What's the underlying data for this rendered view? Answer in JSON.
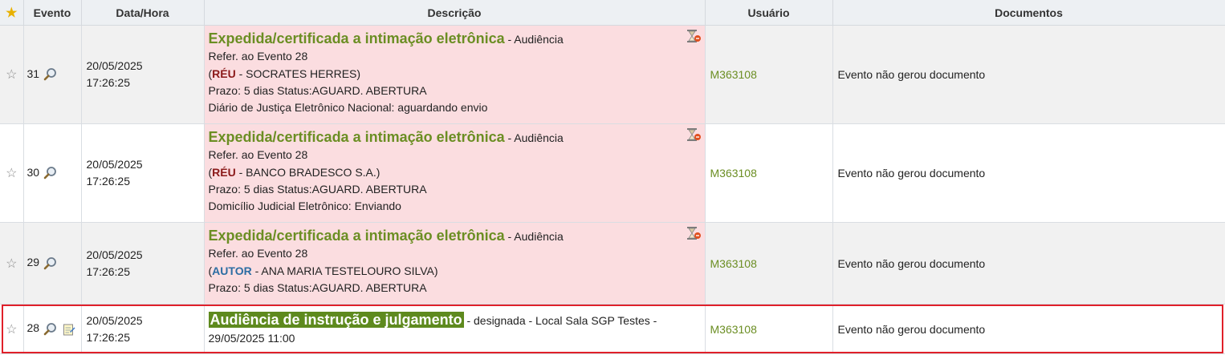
{
  "header": {
    "evento": "Evento",
    "data_hora": "Data/Hora",
    "descricao": "Descrição",
    "usuario": "Usuário",
    "documentos": "Documentos"
  },
  "rows": [
    {
      "evento": "31",
      "date": "20/05/2025",
      "time": "17:26:25",
      "title": "Expedida/certificada a intimação eletrônica",
      "title_suffix": " - Audiência",
      "refer": "Refer. ao Evento 28",
      "party_role": "RÉU",
      "party_name": " - SOCRATES HERRES)",
      "prazo": "Prazo: 5 dias Status:AGUARD. ABERTURA",
      "extra": "Diário de Justiça Eletrônico Nacional: aguardando envio",
      "usuario": "M363108",
      "documentos": "Evento não gerou documento"
    },
    {
      "evento": "30",
      "date": "20/05/2025",
      "time": "17:26:25",
      "title": "Expedida/certificada a intimação eletrônica",
      "title_suffix": " - Audiência",
      "refer": "Refer. ao Evento 28",
      "party_role": "RÉU",
      "party_name": " - BANCO BRADESCO S.A.)",
      "prazo": "Prazo: 5 dias Status:AGUARD. ABERTURA",
      "extra": "Domicílio Judicial Eletrônico: Enviando",
      "usuario": "M363108",
      "documentos": "Evento não gerou documento"
    },
    {
      "evento": "29",
      "date": "20/05/2025",
      "time": "17:26:25",
      "title": "Expedida/certificada a intimação eletrônica",
      "title_suffix": " - Audiência",
      "refer": "Refer. ao Evento 28",
      "party_role": "AUTOR",
      "party_name": " - ANA MARIA TESTELOURO SILVA)",
      "prazo": "Prazo: 5 dias Status:AGUARD. ABERTURA",
      "usuario": "M363108",
      "documentos": "Evento não gerou documento"
    },
    {
      "evento": "28",
      "date": "20/05/2025",
      "time": "17:26:25",
      "title": "Audiência de instrução e julgamento",
      "title_suffix": " - designada - Local Sala SGP Testes -",
      "line2": "29/05/2025 11:00",
      "usuario": "M363108",
      "documentos": "Evento não gerou documento"
    }
  ],
  "paren_open": "(",
  "colors": {
    "accent_green": "#6b8e23",
    "pink_row": "#fbdde0",
    "highlight_border": "#e0202a"
  },
  "icons": [
    "star-icon",
    "magnifier-icon",
    "note-edit-icon",
    "hourglass-icon"
  ]
}
